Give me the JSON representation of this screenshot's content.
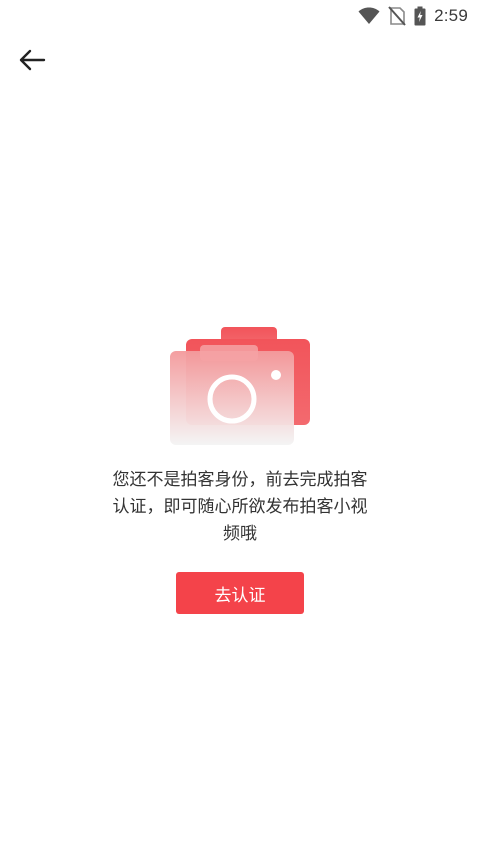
{
  "status_bar": {
    "time": "2:59",
    "icons": [
      "wifi-icon",
      "no-sim-icon",
      "battery-charging-icon"
    ]
  },
  "header": {
    "back_icon": "arrow-left-icon"
  },
  "empty_state": {
    "illustration": "camera-icon",
    "message_lines": [
      "您还不是拍客身份，前去完成拍客",
      "认证，即可随心所欲发布拍客小视",
      "频哦"
    ],
    "button_label": "去认证"
  },
  "colors": {
    "accent": "#f4434a",
    "text": "#333333"
  }
}
